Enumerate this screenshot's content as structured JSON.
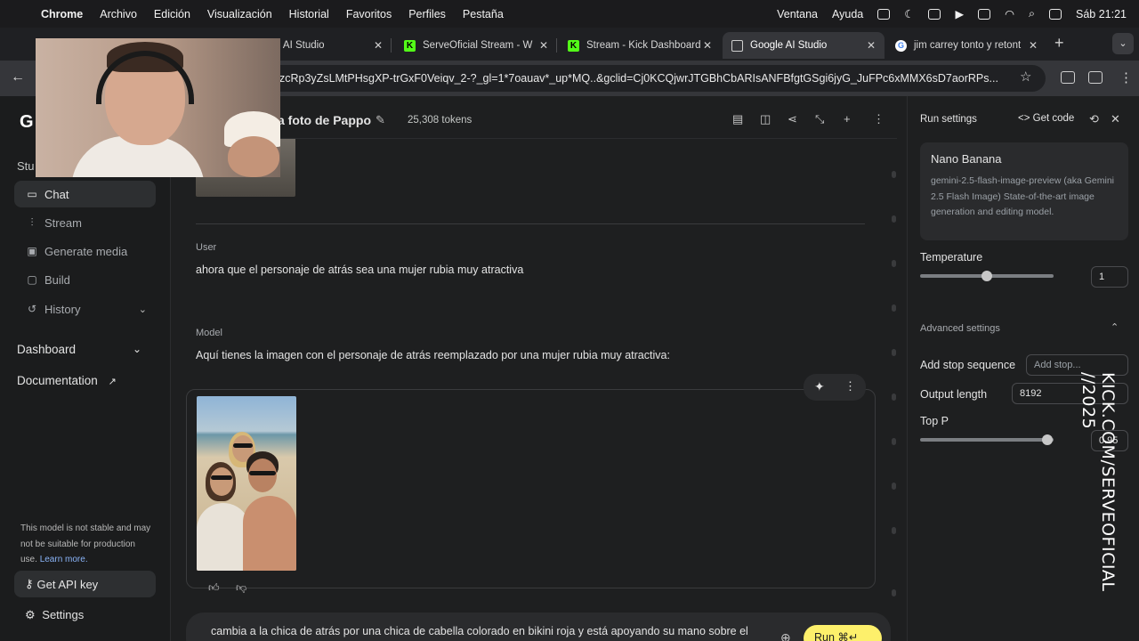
{
  "menubar": {
    "apple": "",
    "items": [
      "Chrome",
      "Archivo",
      "Edición",
      "Visualización",
      "Historial",
      "Favoritos",
      "Perfiles",
      "Pestaña"
    ],
    "right_items": [
      "Ventana",
      "Ayuda"
    ],
    "clock": "Sáb  21:21"
  },
  "tabs": [
    {
      "title": "gle AI Studio",
      "icon": "google-ai-studio-icon"
    },
    {
      "title": "ServeOficial Stream - W",
      "icon": "kick-icon"
    },
    {
      "title": "Stream - Kick Dashboard",
      "icon": "kick-icon"
    },
    {
      "title": "Google AI Studio",
      "icon": "google-ai-studio-icon",
      "active": true
    },
    {
      "title": "jim carrey tonto y retont",
      "icon": "google-icon"
    }
  ],
  "toolbar": {
    "url": "zcRp3yZsLMtPHsgXP-trGxF0Veiqv_2-?_gl=1*7oauav*_up*MQ..&gclid=Cj0KCQjwrJTGBhCbARIsANFBfgtGSgi6jyG_JuFPc6xMMX6sD7aorRPs..."
  },
  "sidebar": {
    "logo": "G",
    "studio_label": "Stu",
    "nav": [
      {
        "label": "Chat",
        "icon": "chat-icon",
        "active": true
      },
      {
        "label": "Stream",
        "icon": "stream-icon"
      },
      {
        "label": "Generate media",
        "icon": "image-icon"
      },
      {
        "label": "Build",
        "icon": "build-icon"
      },
      {
        "label": "History",
        "icon": "history-icon"
      }
    ],
    "dashboard": "Dashboard",
    "documentation": "Documentation",
    "note_text": "This model is not stable and may not be suitable for production use.",
    "note_link": "Learn more.",
    "api_key": "Get API key",
    "settings": "Settings"
  },
  "header": {
    "title": "a foto de Pappo",
    "tokens": "25,308 tokens"
  },
  "chat": {
    "user_role": "User",
    "user_message": "ahora que el personaje de atrás sea una mujer rubia muy atractiva",
    "model_role": "Model",
    "model_message": "Aquí tienes la imagen con el personaje de atrás reemplazado por una mujer rubia muy atractiva:",
    "input_text": "cambia a la chica de atrás por una chica de cabella colorado en bikini roja y está apoyando su mano sobre el",
    "run_label": "Run ⌘↵"
  },
  "run_settings": {
    "title": "Run settings",
    "get_code": "Get code",
    "model_name": "Nano Banana",
    "model_desc": "gemini-2.5-flash-image-preview (aka Gemini 2.5 Flash Image) State-of-the-art image generation and editing model.",
    "temperature_label": "Temperature",
    "temperature_value": "1",
    "temperature_fraction": 0.5,
    "advanced_label": "Advanced settings",
    "stop_label": "Add stop sequence",
    "stop_placeholder": "Add stop...",
    "output_label": "Output length",
    "output_value": "8192",
    "topp_label": "Top P",
    "topp_value": "0.95",
    "topp_fraction": 0.95
  },
  "watermark": "KICK.COM/SERVEOFICIAL\n//2025"
}
